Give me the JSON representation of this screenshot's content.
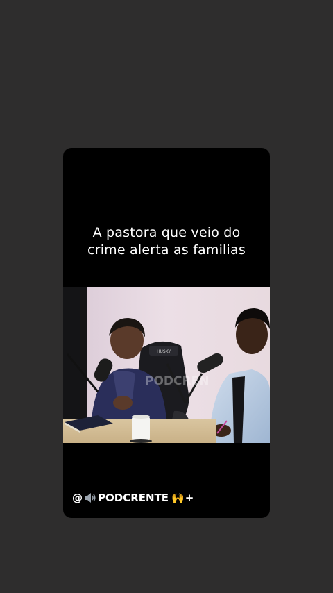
{
  "story": {
    "caption_lines": [
      "A pastora que veio do",
      "crime alerta as familias"
    ],
    "footer": {
      "prefix": "@",
      "handle": "PODCRENTE",
      "suffix": "+",
      "speaker_icon": "speaker-icon",
      "hands_icon": "raised-hands-icon"
    },
    "video": {
      "chair_brand": "HUSKY",
      "watermark": "PODCREN"
    }
  },
  "colors": {
    "background": "#2e2d2d",
    "card": "#000000",
    "text": "#ffffff"
  }
}
